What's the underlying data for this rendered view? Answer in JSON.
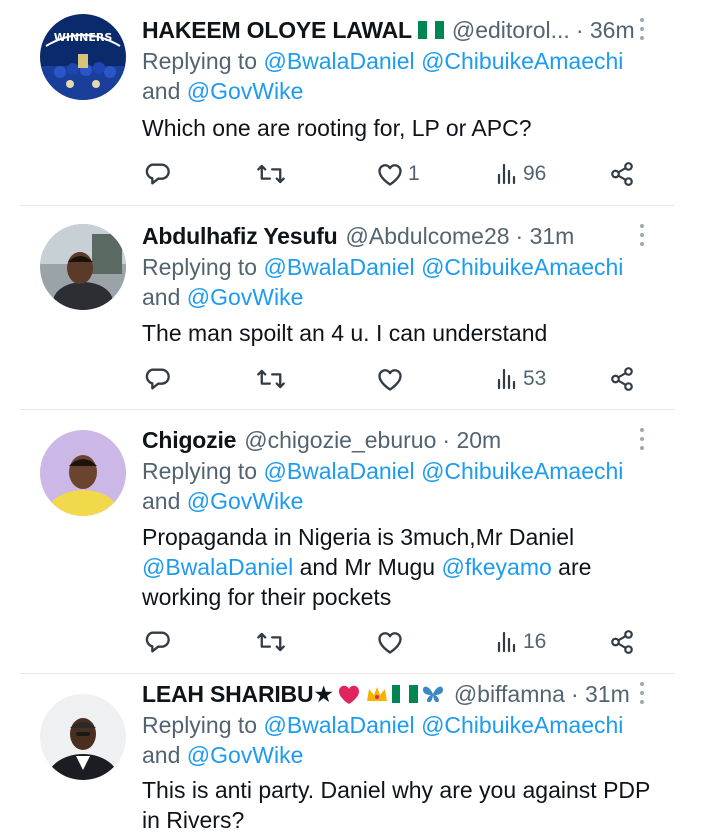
{
  "tweets": [
    {
      "name": "HAKEEM OLOYE LAWAL",
      "handle": "@editorol...",
      "time": "· 36m",
      "flag": "nigeria-flag",
      "reply_prefix": "Replying to ",
      "mention_1": "@BwalaDaniel",
      "mention_2": "@ChibuikeAmaechi",
      "and": "and ",
      "mention_3": "@GovWike",
      "text": "Which one are rooting for, LP or APC?",
      "likes": "1",
      "views": "96"
    },
    {
      "name": "Abdulhafiz Yesufu",
      "handle": "@Abdulcome28",
      "time": "· 31m",
      "reply_prefix": "Replying to ",
      "mention_1": "@BwalaDaniel",
      "mention_2": "@ChibuikeAmaechi",
      "and": "and ",
      "mention_3": "@GovWike",
      "text": "The man spoilt an 4 u. I can understand",
      "likes": "",
      "views": "53"
    },
    {
      "name": "Chigozie",
      "handle": "@chigozie_eburuo",
      "time": "· 20m",
      "reply_prefix": "Replying to ",
      "mention_1": "@BwalaDaniel",
      "mention_2": "@ChibuikeAmaechi",
      "and": "and ",
      "mention_3": "@GovWike",
      "text_1": "Propaganda in Nigeria is 3much,Mr Daniel",
      "text_mention_1": "@BwalaDaniel",
      "text_2": " and Mr Mugu ",
      "text_mention_2": "@fkeyamo",
      "text_3": " are",
      "text_4": "working for their pockets",
      "likes": "",
      "views": "16"
    },
    {
      "name": "LEAH SHARIBU★",
      "handle": "@biffamna",
      "time": "· 31m",
      "emojis": [
        "heart",
        "crown",
        "nigeria-flag",
        "butterfly"
      ],
      "reply_prefix": "Replying to ",
      "mention_1": "@BwalaDaniel",
      "mention_2": "@ChibuikeAmaechi",
      "and": "and ",
      "mention_3": "@GovWike",
      "text_1": "This is anti party. Daniel why are you against PDP",
      "text_2": "in Rivers?"
    }
  ],
  "icons": {
    "reply": "reply-icon",
    "retweet": "retweet-icon",
    "like": "heart-icon",
    "views": "views-icon",
    "share": "share-icon",
    "more": "more-vertical-icon"
  },
  "colors": {
    "accent": "#1d9bf0",
    "secondary_text": "#536471",
    "primary_text": "#0f1419",
    "divider": "#e6e9ec",
    "heart_emoji": "#e0245e",
    "crown": "#f5b400",
    "nigeria_green": "#008751",
    "butterfly": "#3b88c3"
  }
}
